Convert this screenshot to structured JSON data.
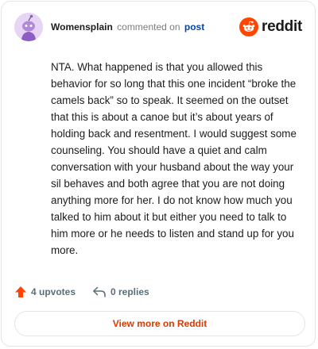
{
  "header": {
    "author": "Womensplain",
    "action_text": "commented on",
    "post_link": "post",
    "brand": "reddit"
  },
  "comment": {
    "body": "NTA. What happened is that you allowed this behavior for so long that this one incident “broke the camels back” so to speak. It seemed on the outset that this is about a canoe but it’s about years of holding back and resentment. I would suggest some counseling. You should have a quiet and calm conversation with your husband about the way your sil behaves and both agree that you are not doing anything more for her. I do not know how much you talked to him about it but either you need to talk to him more or he needs to listen and stand up for you more."
  },
  "actions": {
    "upvotes": "4 upvotes",
    "replies": "0 replies"
  },
  "footer": {
    "view_more": "View more on Reddit"
  },
  "colors": {
    "brand_orange": "#ff4500",
    "link_blue": "#0045ac",
    "view_more_text": "#d93a00",
    "avatar_bg": "#e7d5f6"
  },
  "icons": {
    "avatar": "snoo-avatar-icon",
    "brand": "reddit-logo-icon",
    "upvote": "upvote-arrow-icon",
    "reply": "reply-arrow-icon"
  }
}
